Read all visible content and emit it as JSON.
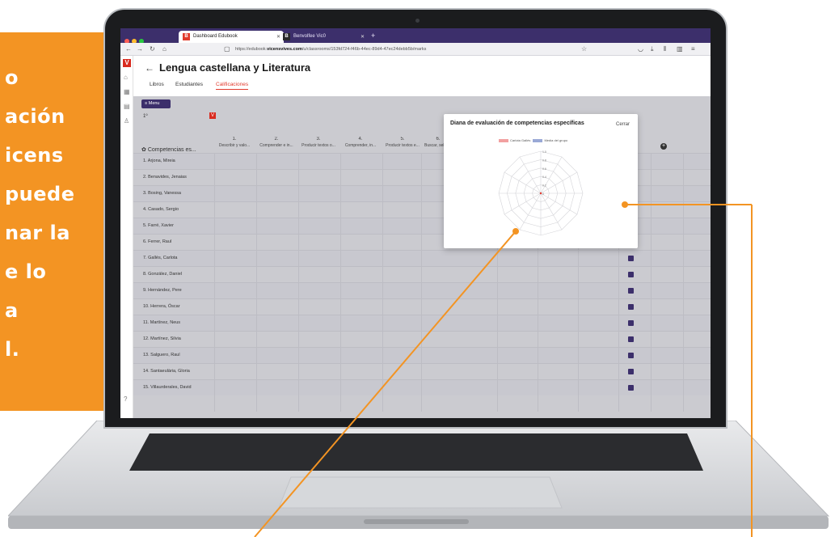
{
  "promo": {
    "lines": [
      "o",
      "ación",
      "icens",
      "puede",
      "nar la",
      "e lo",
      "a",
      "l."
    ]
  },
  "browser": {
    "tabs": [
      {
        "label": "Dashboard Edubook",
        "favicon": "B"
      },
      {
        "label": "Benvolfee Vic0",
        "favicon": "B"
      }
    ],
    "url_prefix": "https://edubook.",
    "url_domain": "vicensvives.com",
    "url_suffix": "/u/classrooms/153fd724-f46b-44ec-89d4-47ec24debb5b/marks"
  },
  "app": {
    "logo": "V",
    "title": "Lengua castellana y Literatura",
    "subtabs": [
      "Libros",
      "Estudiantes",
      "Calificaciones"
    ],
    "menu_label": "≡ Menu",
    "course": "1º",
    "competencies_header": "Competencias es...",
    "columns": [
      {
        "num": "1.",
        "label": "Describir y valo..."
      },
      {
        "num": "2.",
        "label": "Comprender e in..."
      },
      {
        "num": "3.",
        "label": "Producir textos o..."
      },
      {
        "num": "4.",
        "label": "Comprender, in..."
      },
      {
        "num": "5.",
        "label": "Producir textos e..."
      },
      {
        "num": "6.",
        "label": "Buscar, selec..."
      }
    ],
    "students": [
      "1. Arjona, Mireia",
      "2. Benavides, Jenaias",
      "3. Bosing, Vanessa",
      "4. Casado, Sergio",
      "5. Farré, Xavier",
      "6. Ferrer, Raul",
      "7. Gallés, Carlota",
      "8. González, Daniel",
      "9. Hernández, Pere",
      "10. Herrera, Óscar",
      "11. Martínez, Neus",
      "12. Martínez, Silvia",
      "13. Salguero, Raul",
      "14. Santaeulària, Gloria",
      "15. Villaurderales, David"
    ]
  },
  "modal": {
    "title": "Diana de evaluación de competencias específicas",
    "close_label": "Cerrar",
    "legend": [
      "Carlota Gallés",
      "Media del grupo"
    ],
    "axis_ticks": [
      "1.0",
      "0.8",
      "0.6",
      "0.4",
      "0.2",
      "0"
    ],
    "colors": {
      "student": "#f2a0a0",
      "group": "#9aa9d6"
    }
  },
  "colors": {
    "accent_orange": "#f39423",
    "brand_purple": "#3c2f6b",
    "brand_red": "#d92b1f"
  }
}
